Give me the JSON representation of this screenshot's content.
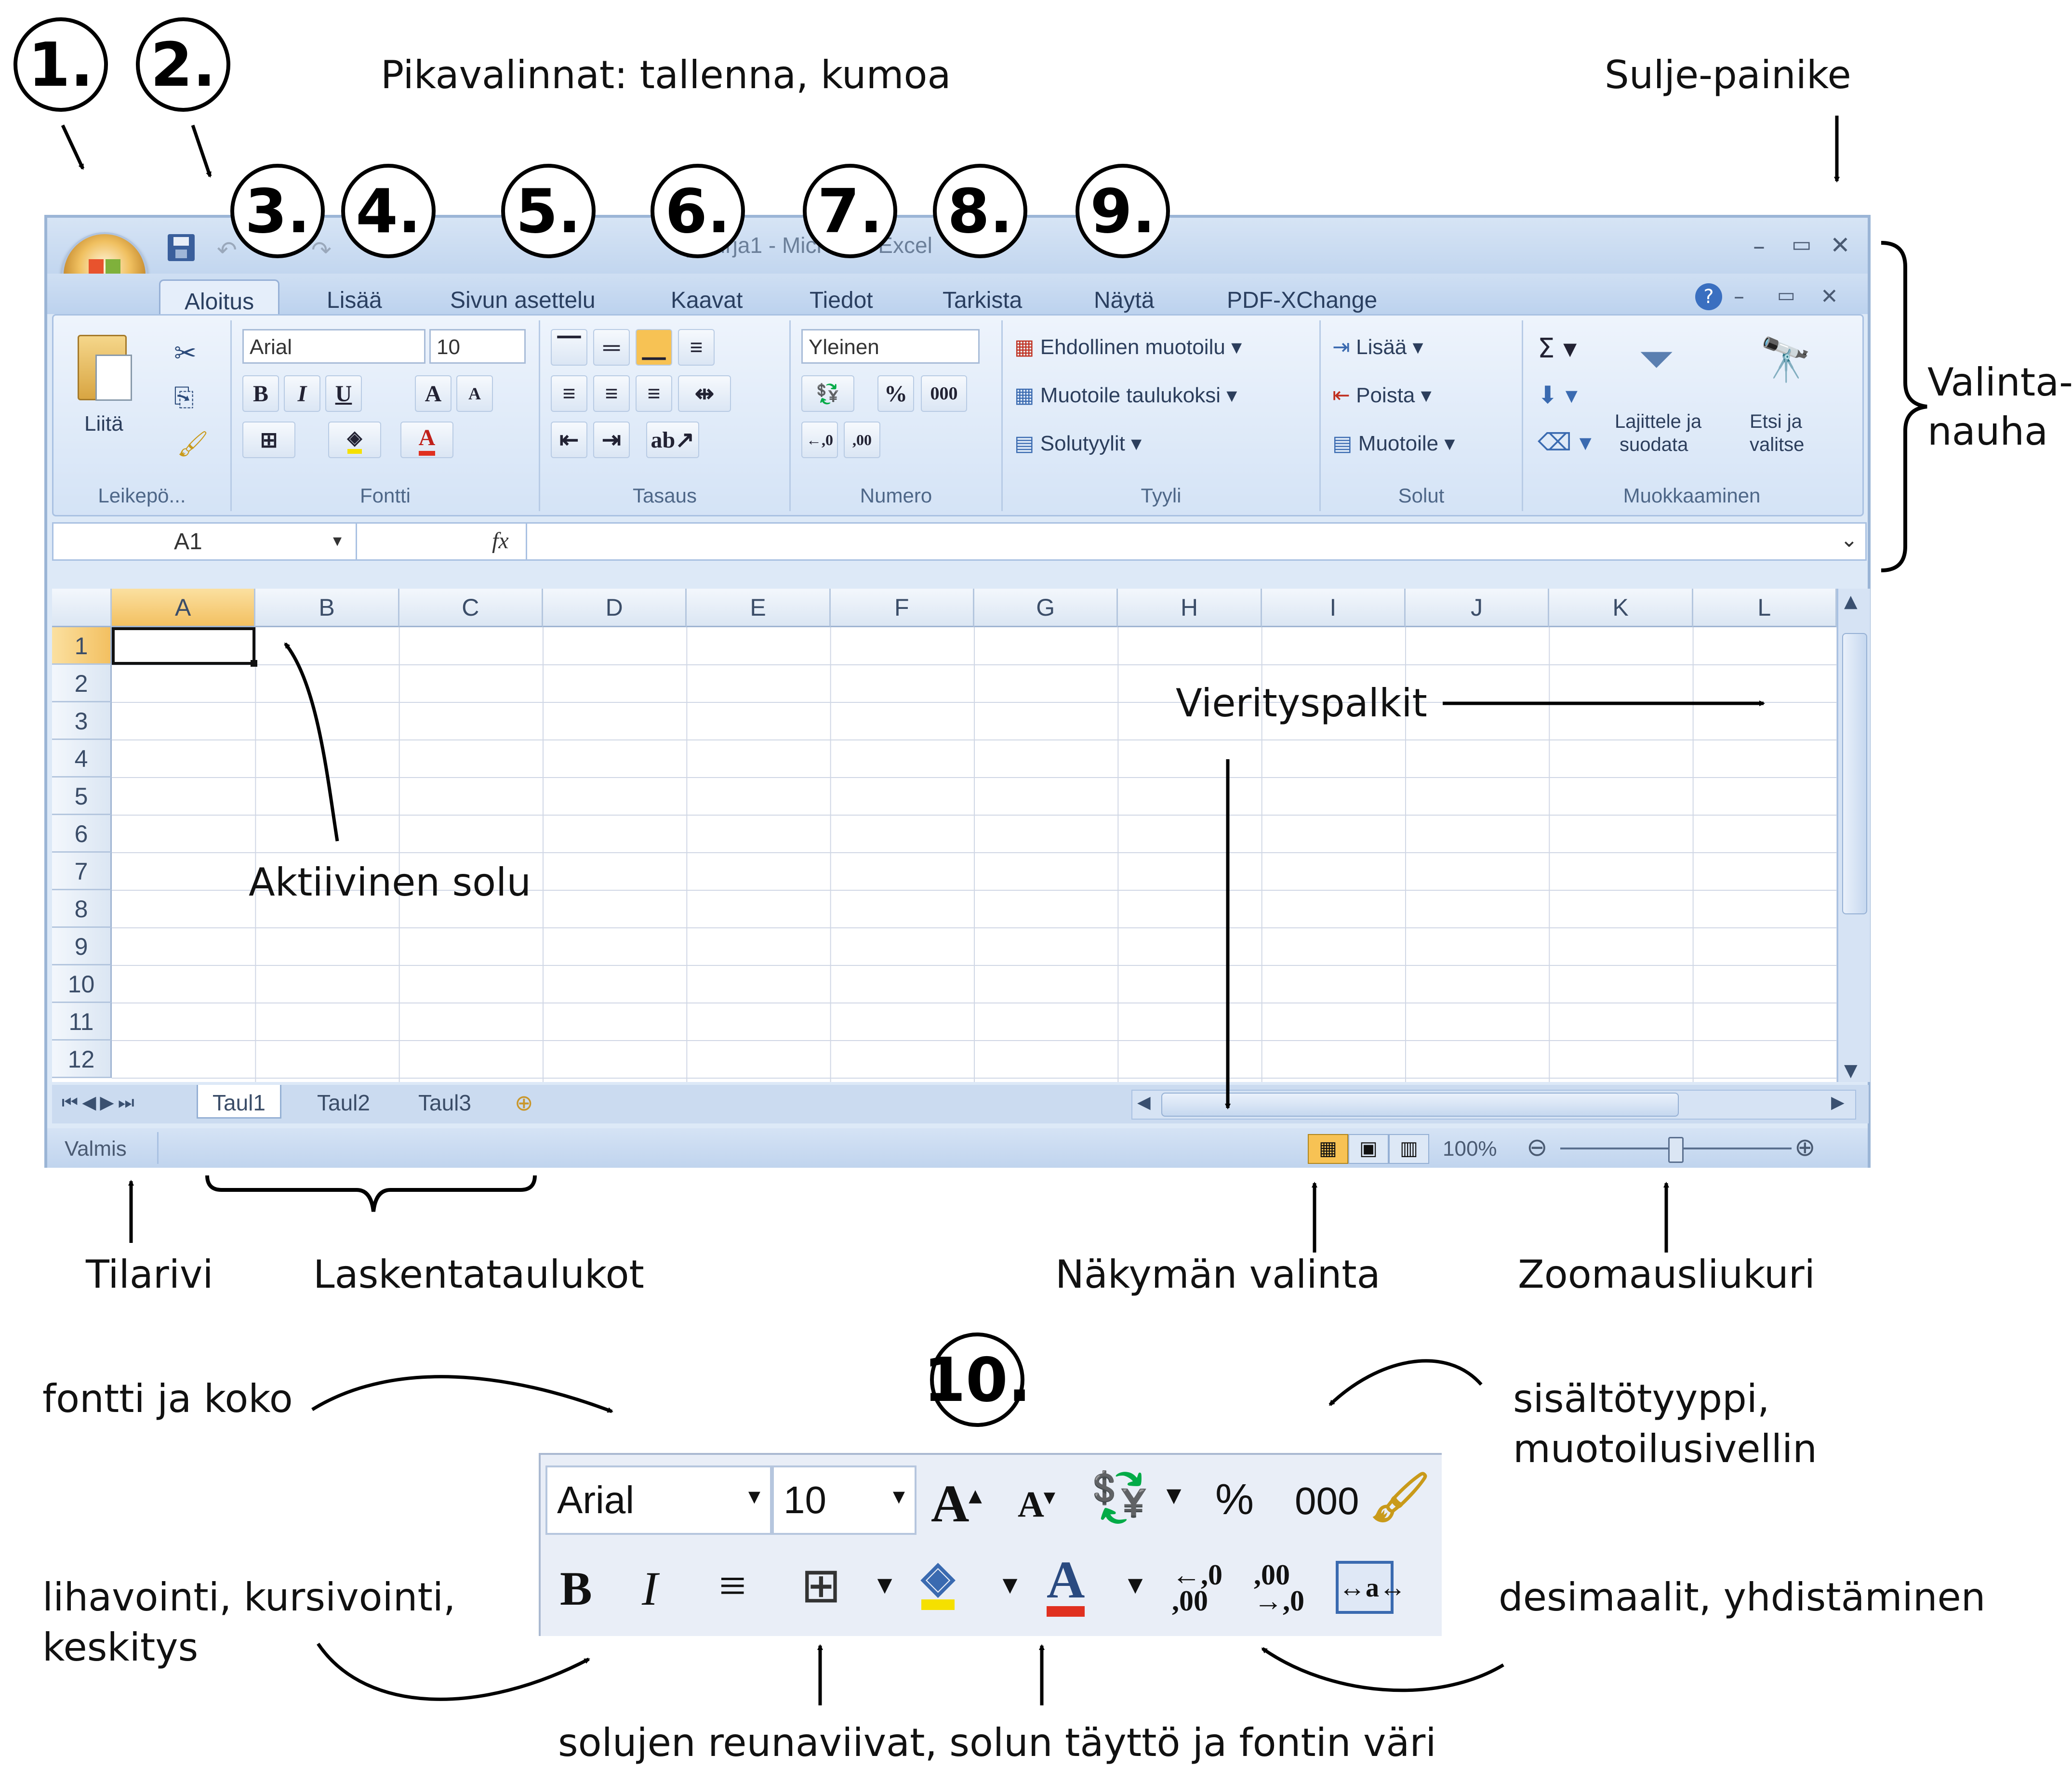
{
  "callouts": {
    "n1": "1.",
    "n2": "2.",
    "n3": "3.",
    "n4": "4.",
    "n5": "5.",
    "n6": "6.",
    "n7": "7.",
    "n8": "8.",
    "n9": "9.",
    "n10": "10."
  },
  "labels": {
    "quick_access": "Pikavalinnat: tallenna, kumoa",
    "close_button": "Sulje-painike",
    "ribbon_line1": "Valinta-",
    "ribbon_line2": "nauha",
    "scrollbars": "Vierityspalkit",
    "active_cell": "Aktiivinen solu",
    "status_bar": "Tilarivi",
    "worksheets": "Laskentataulukot",
    "view_select": "Näkymän valinta",
    "zoom_slider": "Zoomausliukuri",
    "font_size": "fontti ja koko",
    "content_type_line1": "sisältötyyppi,",
    "content_type_line2": "muotoilusivellin",
    "bold_italic_line1": "lihavointi, kursivointi,",
    "bold_italic_line2": "keskitys",
    "decimals": "desimaalit, yhdistäminen",
    "borders_fill": "solujen reunaviivat, solun täyttö ja fontin väri"
  },
  "window": {
    "title": "Työkirja1 - Microsoft Excel",
    "tabs": [
      "Aloitus",
      "Lisää",
      "Sivun asettelu",
      "Kaavat",
      "Tiedot",
      "Tarkista",
      "Näytä",
      "PDF-XChange"
    ],
    "active_tab": "Aloitus"
  },
  "ribbon": {
    "clipboard": {
      "paste": "Liitä",
      "group": "Leikepö..."
    },
    "font": {
      "name": "Arial",
      "size": "10",
      "group": "Fontti"
    },
    "alignment": {
      "group": "Tasaus"
    },
    "number": {
      "format": "Yleinen",
      "percent": "%",
      "thousands": "000",
      "group": "Numero"
    },
    "styles": {
      "conditional": "Ehdollinen muotoilu",
      "as_table": "Muotoile taulukoksi",
      "cell_styles": "Solutyylit",
      "group": "Tyyli"
    },
    "cells": {
      "insert": "Lisää",
      "delete": "Poista",
      "format": "Muotoile",
      "group": "Solut"
    },
    "editing": {
      "sort_line1": "Lajittele ja",
      "sort_line2": "suodata",
      "find_line1": "Etsi ja",
      "find_line2": "valitse",
      "group": "Muokkaaminen"
    }
  },
  "formula_bar": {
    "name_box": "A1",
    "fx": "fx"
  },
  "sheet": {
    "columns": [
      "A",
      "B",
      "C",
      "D",
      "E",
      "F",
      "G",
      "H",
      "I",
      "J",
      "K",
      "L"
    ],
    "rows": [
      "1",
      "2",
      "3",
      "4",
      "5",
      "6",
      "7",
      "8",
      "9",
      "10",
      "11",
      "12"
    ],
    "tabs": [
      "Taul1",
      "Taul2",
      "Taul3"
    ]
  },
  "status": {
    "ready": "Valmis",
    "zoom": "100%"
  },
  "toolbar10": {
    "font": "Arial",
    "size": "10",
    "percent": "%",
    "thousands": "000"
  },
  "colors": {
    "accent": "#f7c254",
    "fill_yellow": "#f5e000",
    "font_red": "#e03020",
    "ribbon_blue": "#c2d6ef"
  }
}
